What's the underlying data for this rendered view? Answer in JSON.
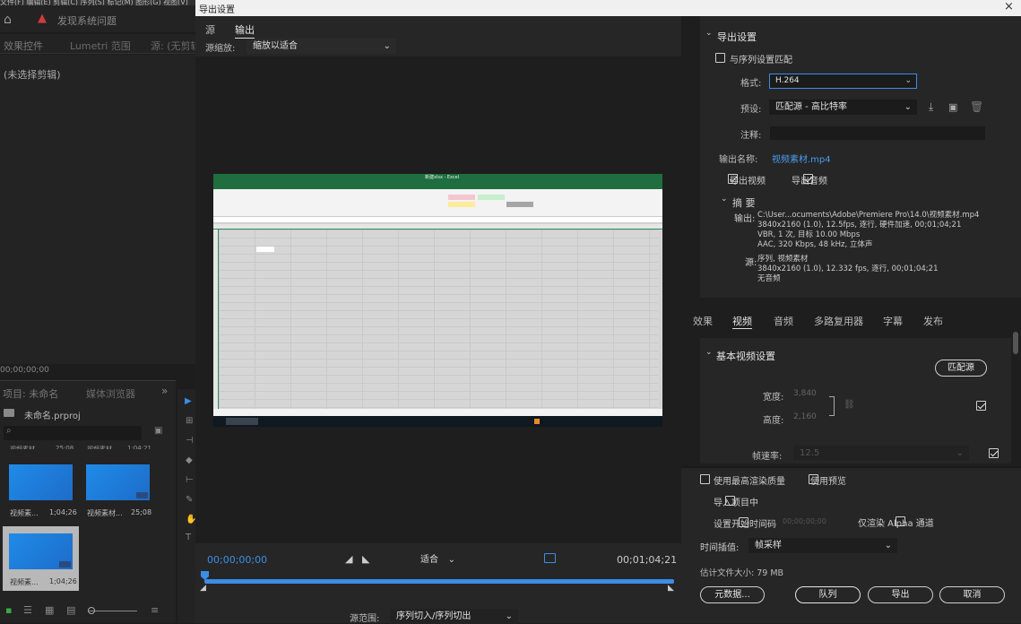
{
  "app": {
    "title_partial": "文件(F) 编辑(E) 剪辑(C) 序列(S) 标记(M) 图形(G) 视图(V)",
    "warning": "发现系统问题",
    "tabs": [
      "效果控件",
      "Lumetri 范围",
      "源: (无剪辑)"
    ],
    "no_clip": "(未选择剪辑)",
    "time": "00;00;00;00"
  },
  "project": {
    "tabs": [
      "项目: 未命名",
      "媒体浏览器"
    ],
    "filename": "未命名.prproj",
    "items": [
      {
        "name": "视频素...",
        "dur": "1;04;26"
      },
      {
        "name": "视频素材...",
        "dur": "25;08"
      },
      {
        "name": "视频素...",
        "dur": "1;04;26"
      }
    ],
    "top_items": [
      {
        "name": "视频素材...",
        "dur": "25;08"
      },
      {
        "name": "视频素材...",
        "dur": "1;04;21"
      }
    ]
  },
  "dialog": {
    "title": "导出设置",
    "close": "×",
    "preview_tabs": [
      "源",
      "输出"
    ],
    "source_scale_label": "源缩放:",
    "source_scale_value": "缩放以适合",
    "timecode_start": "00;00;00;00",
    "timecode_end": "00;01;04;21",
    "fit_value": "适合",
    "source_range_label": "源范围:",
    "source_range_value": "序列切入/序列切出",
    "excel_title": "新建xlsx - Excel",
    "export_settings": {
      "header": "导出设置",
      "match_sequence": "与序列设置匹配",
      "format_label": "格式:",
      "format_value": "H.264",
      "preset_label": "预设:",
      "preset_value": "匹配源 - 高比特率",
      "comments_label": "注释:",
      "output_name_label": "输出名称:",
      "output_name_value": "视频素材.mp4",
      "export_video": "导出视频",
      "export_audio": "导出音频",
      "summary_header": "摘 要",
      "summary_output_label": "输出:",
      "summary_output_lines": [
        "C:\\User...ocuments\\Adobe\\Premiere Pro\\14.0\\视频素材.mp4",
        "3840x2160 (1.0), 12.5fps, 逐行, 硬件加速, 00;01;04;21",
        "VBR, 1 次, 目标 10.00 Mbps",
        "AAC, 320 Kbps, 48 kHz, 立体声"
      ],
      "summary_source_label": "源:",
      "summary_source_lines": [
        "序列, 视频素材",
        "3840x2160 (1.0), 12.332 fps, 逐行, 00;01;04;21",
        "无音频"
      ]
    },
    "settings_tabs": [
      "效果",
      "视频",
      "音频",
      "多路复用器",
      "字幕",
      "发布"
    ],
    "basic_video": {
      "header": "基本视频设置",
      "match_source": "匹配源",
      "width_label": "宽度:",
      "width_value": "3,840",
      "height_label": "高度:",
      "height_value": "2,160",
      "fps_label": "帧速率:",
      "fps_value": "12.5"
    },
    "options": {
      "max_render": "使用最高渲染质量",
      "use_previews": "使用预览",
      "import_project": "导入项目中",
      "set_start_tc": "设置开始时间码",
      "start_tc_value": "00;00;00;00",
      "alpha_only": "仅渲染 Alpha 通道",
      "time_interp_label": "时间插值:",
      "time_interp_value": "帧采样",
      "est_size": "估计文件大小: 79 MB"
    },
    "buttons": {
      "metadata": "元数据...",
      "queue": "队列",
      "export": "导出",
      "cancel": "取消"
    }
  }
}
